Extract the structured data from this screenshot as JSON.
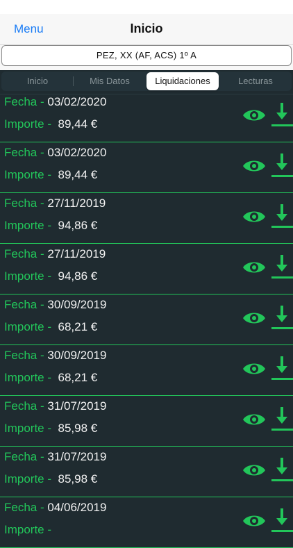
{
  "nav": {
    "left": "Menu",
    "title": "Inicio"
  },
  "address": "PEZ, XX (AF, ACS) 1º A",
  "tabs": [
    "Inicio",
    "Mis Datos",
    "Liquidaciones",
    "Lecturas"
  ],
  "active_tab": "Liquidaciones",
  "labels": {
    "fecha": "Fecha -",
    "importe": "Importe -"
  },
  "rows": [
    {
      "fecha": "03/02/2020",
      "importe": "89,44 €"
    },
    {
      "fecha": "03/02/2020",
      "importe": "89,44 €"
    },
    {
      "fecha": "27/11/2019",
      "importe": "94,86 €"
    },
    {
      "fecha": "27/11/2019",
      "importe": "94,86 €"
    },
    {
      "fecha": "30/09/2019",
      "importe": "68,21 €"
    },
    {
      "fecha": "30/09/2019",
      "importe": "68,21 €"
    },
    {
      "fecha": "31/07/2019",
      "importe": "85,98 €"
    },
    {
      "fecha": "31/07/2019",
      "importe": "85,98 €"
    },
    {
      "fecha": "04/06/2019",
      "importe": ""
    }
  ],
  "colors": {
    "accent": "#22c65a",
    "background": "#1f2b30",
    "link": "#1a7cf5"
  },
  "icons": {
    "view": "eye-icon",
    "download": "download-icon"
  }
}
